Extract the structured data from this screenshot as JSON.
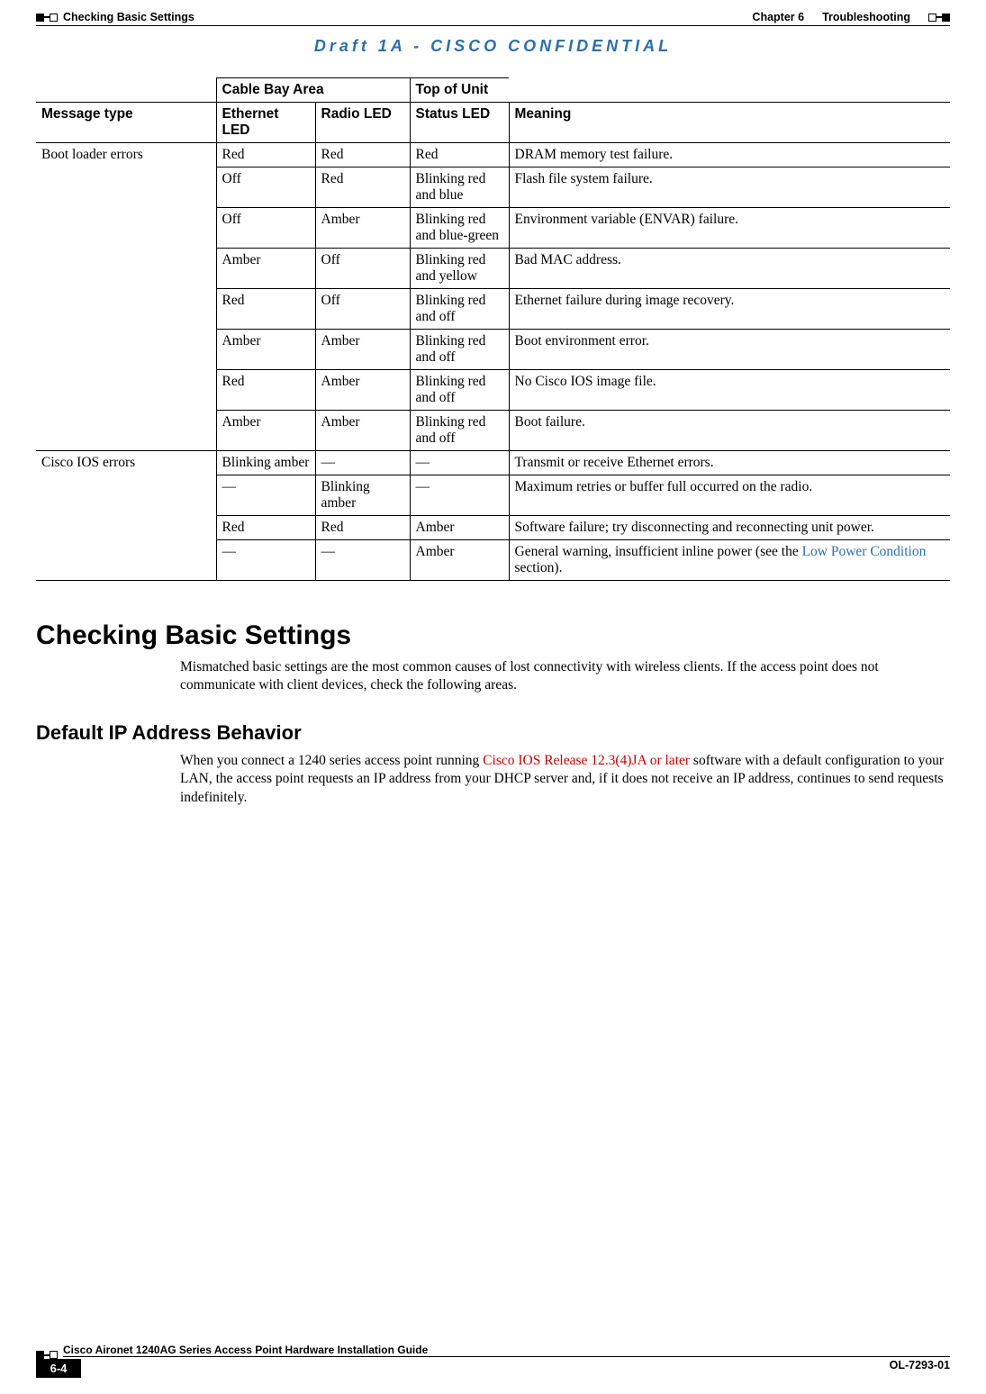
{
  "header": {
    "left_title": "Checking Basic Settings",
    "chapter": "Chapter 6",
    "chapter_name": "Troubleshooting"
  },
  "draft_line": "Draft 1A - CISCO CONFIDENTIAL",
  "table": {
    "group1_header": "Cable Bay Area",
    "group2_header": "Top of Unit",
    "col_headers": {
      "message_type": "Message type",
      "ethernet": "Ethernet LED",
      "radio": "Radio LED",
      "status": "Status LED",
      "meaning": "Meaning"
    },
    "boot_loader_label": "Boot loader errors",
    "ios_errors_label": "Cisco IOS errors",
    "boot_rows": [
      {
        "ethernet": "Red",
        "radio": "Red",
        "status": "Red",
        "meaning": "DRAM memory test failure."
      },
      {
        "ethernet": "Off",
        "radio": "Red",
        "status": "Blinking red and blue",
        "meaning": "Flash file system failure."
      },
      {
        "ethernet": "Off",
        "radio": "Amber",
        "status": "Blinking red and blue-green",
        "meaning": "Environment variable (ENVAR) failure."
      },
      {
        "ethernet": "Amber",
        "radio": "Off",
        "status": "Blinking red and yellow",
        "meaning": "Bad MAC address."
      },
      {
        "ethernet": "Red",
        "radio": "Off",
        "status": "Blinking red and off",
        "meaning": "Ethernet failure during image recovery."
      },
      {
        "ethernet": "Amber",
        "radio": "Amber",
        "status": "Blinking red and off",
        "meaning": "Boot environment error."
      },
      {
        "ethernet": "Red",
        "radio": "Amber",
        "status": "Blinking red and off",
        "meaning": "No Cisco IOS image file."
      },
      {
        "ethernet": "Amber",
        "radio": "Amber",
        "status": "Blinking red and off",
        "meaning": "Boot failure."
      }
    ],
    "ios_rows": [
      {
        "ethernet": "Blinking amber",
        "radio": "—",
        "status": "—",
        "meaning": "Transmit or receive Ethernet errors."
      },
      {
        "ethernet": "—",
        "radio": "Blinking amber",
        "status": "—",
        "meaning": "Maximum retries or buffer full occurred on the radio."
      },
      {
        "ethernet": "Red",
        "radio": "Red",
        "status": "Amber",
        "meaning": "Software failure; try disconnecting and reconnecting unit power."
      },
      {
        "ethernet": "—",
        "radio": "—",
        "status": "Amber",
        "meaning_pre": "General warning, insufficient inline power (see the ",
        "meaning_link": "Low Power Condition",
        "meaning_post": " section)."
      }
    ]
  },
  "section": {
    "heading": "Checking Basic Settings",
    "para": "Mismatched basic settings are the most common causes of lost connectivity with wireless clients. If the access point does not communicate with client devices, check the following areas."
  },
  "subsection": {
    "heading": "Default IP Address Behavior",
    "para_pre": "When you connect a 1240 series access point running ",
    "para_red": "Cisco IOS Release 12.3(4)JA or later",
    "para_post": " software with a default configuration to your LAN, the access point requests an IP address from your DHCP server and, if it does not receive an IP address, continues to send requests indefinitely."
  },
  "footer": {
    "guide_title": "Cisco Aironet 1240AG Series Access Point Hardware Installation Guide",
    "page_num": "6-4",
    "doc_id": "OL-7293-01"
  }
}
